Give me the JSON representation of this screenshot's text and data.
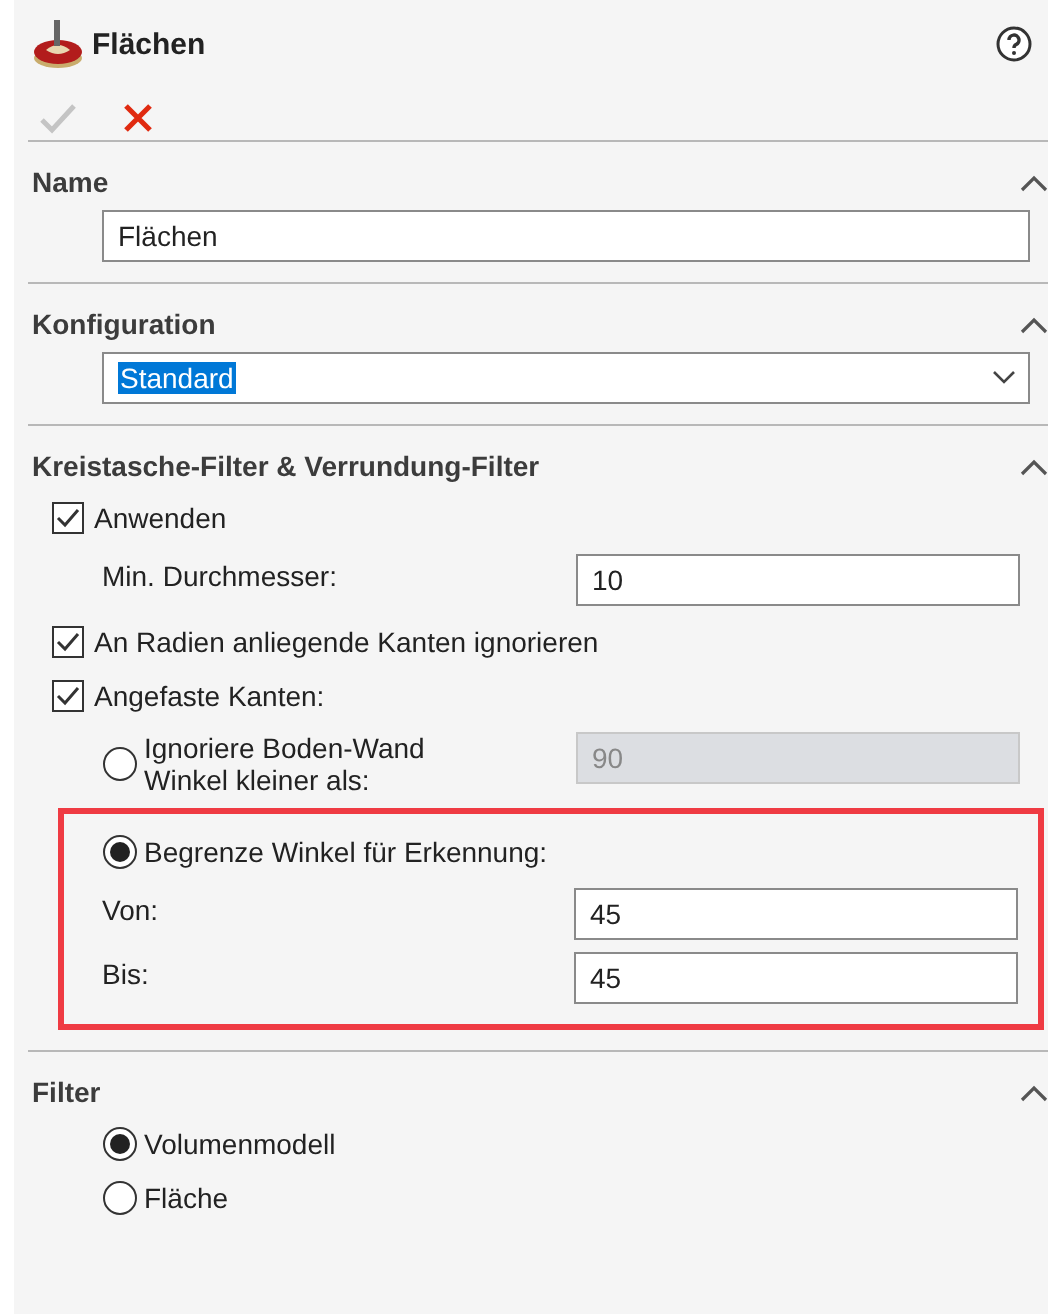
{
  "title": "Flächen",
  "actions": [
    {
      "kind": "ok",
      "disabled": true
    },
    {
      "kind": "cancel",
      "disabled": false
    }
  ],
  "sections": [
    {
      "title": "Name",
      "expanded": true,
      "items": [
        {
          "kind": "textfield",
          "value": "Flächen"
        }
      ]
    },
    {
      "title": "Konfiguration",
      "expanded": true,
      "items": [
        {
          "kind": "dropdown",
          "value": "Standard"
        }
      ]
    },
    {
      "title": "Kreistasche-Filter & Verrundung-Filter",
      "expanded": true,
      "items": [
        {
          "kind": "checkbox",
          "label": "Anwenden",
          "checked": true
        },
        {
          "kind": "numfield",
          "label": "Min. Durchmesser:",
          "value": "10",
          "disabled": false
        },
        {
          "kind": "checkbox",
          "label": "An Radien anliegende Kanten ignorieren",
          "checked": true
        },
        {
          "kind": "checkbox",
          "label": "Angefaste Kanten:",
          "checked": true
        },
        {
          "kind": "radiofield",
          "label": "Ignoriere Boden-Wand\nWinkel kleiner als:",
          "selected": false,
          "value": "90",
          "disabled": true
        },
        {
          "kind": "highlight",
          "items": [
            {
              "kind": "radio",
              "label": "Begrenze Winkel für Erkennung:",
              "selected": true
            },
            {
              "kind": "numfield",
              "label": "Von:",
              "value": "45",
              "disabled": false
            },
            {
              "kind": "numfield",
              "label": "Bis:",
              "value": "45",
              "disabled": false
            }
          ]
        }
      ]
    },
    {
      "title": "Filter",
      "expanded": true,
      "items": [
        {
          "kind": "radio",
          "label": "Volumenmodell",
          "selected": true
        },
        {
          "kind": "radio",
          "label": "Fläche",
          "selected": false
        }
      ]
    }
  ]
}
